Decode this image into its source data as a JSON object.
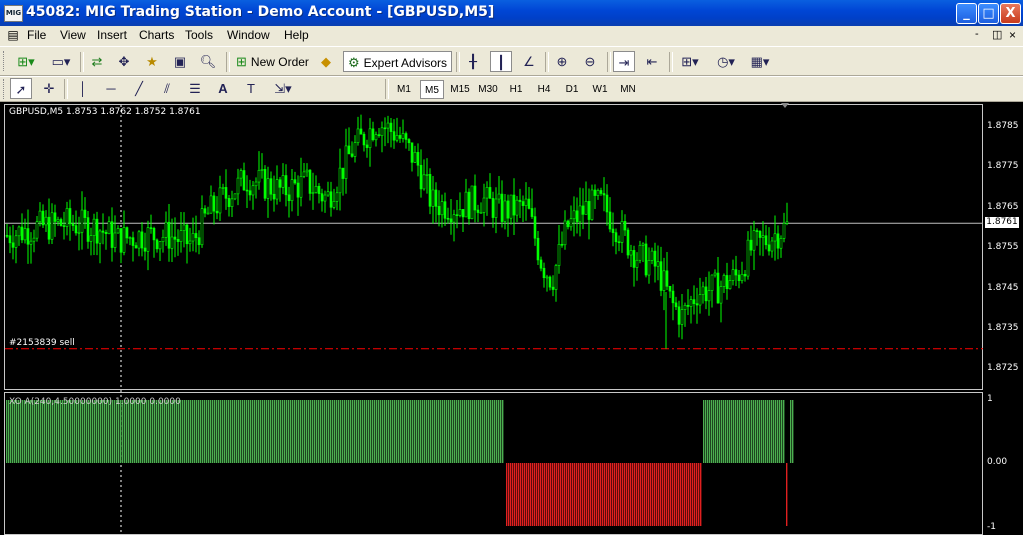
{
  "window": {
    "title": "45082: MIG Trading Station - Demo Account - [GBPUSD,M5]",
    "logo": "MIG"
  },
  "window_controls": {
    "minimize": "_",
    "maximize": "□",
    "close": "X"
  },
  "menu": [
    "File",
    "View",
    "Insert",
    "Charts",
    "Tools",
    "Window",
    "Help"
  ],
  "mdi_controls": [
    "-",
    "◫",
    "×"
  ],
  "toolbar": {
    "new_order": "New Order",
    "expert_advisors": "Expert Advisors"
  },
  "timeframes": [
    "M1",
    "M5",
    "M15",
    "M30",
    "H1",
    "H4",
    "D1",
    "W1",
    "MN"
  ],
  "active_timeframe": "M5",
  "chart": {
    "info": "GBPUSD,M5  1.8753 1.8762 1.8752 1.8761",
    "symbol": "GBPUSD",
    "price_labels": [
      "1.8785",
      "1.8775",
      "1.8765",
      "1.8755",
      "1.8745",
      "1.8735",
      "1.8725"
    ],
    "bid": "1.8761",
    "order_label": "#2153839 sell",
    "colors": {
      "bull": "#00ff00",
      "bear": "#00ff00",
      "order_line": "#ff0000",
      "bid_line": "#c0c0c0"
    }
  },
  "indicator": {
    "label": "XO A(240,4.50000000) 1.0000 0.0000",
    "scale_labels": [
      "1",
      "0.00",
      "-1"
    ],
    "colors": {
      "positive": "#4caf50",
      "negative": "#e02020"
    }
  },
  "chart_data": {
    "type": "candlestick",
    "price_axis_labels": [
      "1.8785",
      "1.8775",
      "1.8765",
      "1.8755",
      "1.8745",
      "1.8735",
      "1.8725"
    ],
    "bid": 1.8761,
    "sell_order_price": 1.873,
    "close_path": [
      [
        0,
        1.8758
      ],
      [
        30,
        1.876
      ],
      [
        60,
        1.8761
      ],
      [
        90,
        1.876
      ],
      [
        110,
        1.8757
      ],
      [
        135,
        1.8758
      ],
      [
        160,
        1.8758
      ],
      [
        185,
        1.8756
      ],
      [
        200,
        1.8763
      ],
      [
        215,
        1.8767
      ],
      [
        240,
        1.8772
      ],
      [
        275,
        1.8769
      ],
      [
        300,
        1.8771
      ],
      [
        320,
        1.8767
      ],
      [
        345,
        1.8779
      ],
      [
        370,
        1.8786
      ],
      [
        390,
        1.8783
      ],
      [
        410,
        1.8776
      ],
      [
        425,
        1.8766
      ],
      [
        450,
        1.8765
      ],
      [
        475,
        1.8767
      ],
      [
        495,
        1.8764
      ],
      [
        520,
        1.8765
      ],
      [
        535,
        1.8751
      ],
      [
        545,
        1.8747
      ],
      [
        560,
        1.876
      ],
      [
        580,
        1.8765
      ],
      [
        595,
        1.8766
      ],
      [
        610,
        1.876
      ],
      [
        630,
        1.8753
      ],
      [
        650,
        1.875
      ],
      [
        665,
        1.8741
      ],
      [
        675,
        1.8738
      ],
      [
        690,
        1.8744
      ],
      [
        710,
        1.8745
      ],
      [
        730,
        1.8748
      ],
      [
        745,
        1.8755
      ],
      [
        760,
        1.8757
      ],
      [
        785,
        1.8761
      ]
    ],
    "indicator_segments": [
      {
        "from_bar": 0,
        "to_bar": 496,
        "value": 1
      },
      {
        "from_bar": 500,
        "to_bar": 694,
        "value": -1
      },
      {
        "from_bar": 697,
        "to_bar": 777,
        "value": 1
      },
      {
        "from_bar": 780,
        "to_bar": 781,
        "value": -1
      },
      {
        "from_bar": 784,
        "to_bar": 786,
        "value": 1
      }
    ]
  }
}
